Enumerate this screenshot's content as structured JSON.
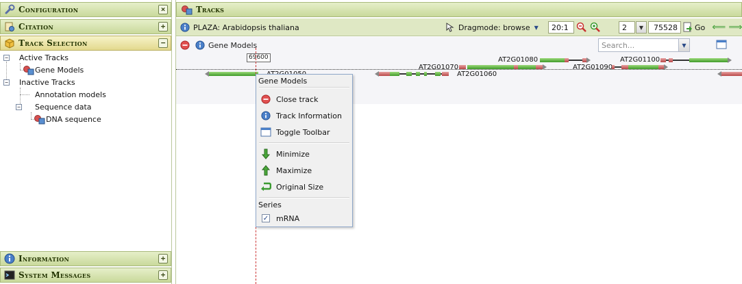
{
  "left": {
    "configuration": {
      "title": "Configuration",
      "button": "×"
    },
    "citation": {
      "title": "Citation",
      "button": "+"
    },
    "track_selection": {
      "title": "Track Selection",
      "button": "−",
      "active_tracks": "Active Tracks",
      "gene_models": "Gene Models",
      "inactive_tracks": "Inactive Tracks",
      "annotation_models": "Annotation models",
      "sequence_data": "Sequence data",
      "dna_sequence": "DNA sequence",
      "collapse_glyph": "−"
    },
    "information": {
      "title": "Information",
      "button": "+"
    },
    "system_messages": {
      "title": "System Messages",
      "button": "+"
    }
  },
  "tracks": {
    "title": "Tracks",
    "toolbar": {
      "species": "PLAZA: Arabidopsis thaliana",
      "dragmode": "Dragmode: browse",
      "zoom": "20:1",
      "chromosome": "2",
      "position": "75528",
      "go": "Go"
    },
    "track": {
      "name": "Gene Models",
      "search_placeholder": "Search...",
      "ruler_label": "69600"
    },
    "genes": {
      "g1": "AT2G01080",
      "g2": "AT2G01070",
      "g3": "AT2G01060",
      "g4": "AT2G01090",
      "g5": "AT2G01100",
      "g6": "AT2G01050"
    }
  },
  "menu": {
    "title": "Gene Models",
    "close_track": "Close track",
    "track_information": "Track Information",
    "toggle_toolbar": "Toggle Toolbar",
    "minimize": "Minimize",
    "maximize": "Maximize",
    "original_size": "Original Size",
    "series": "Series",
    "mrna": "mRNA"
  },
  "colors": {
    "header_green": "#c9d99b",
    "exon_green": "#3f9a2a",
    "utr_red": "#b84848",
    "cursor_line": "#cc3333"
  }
}
